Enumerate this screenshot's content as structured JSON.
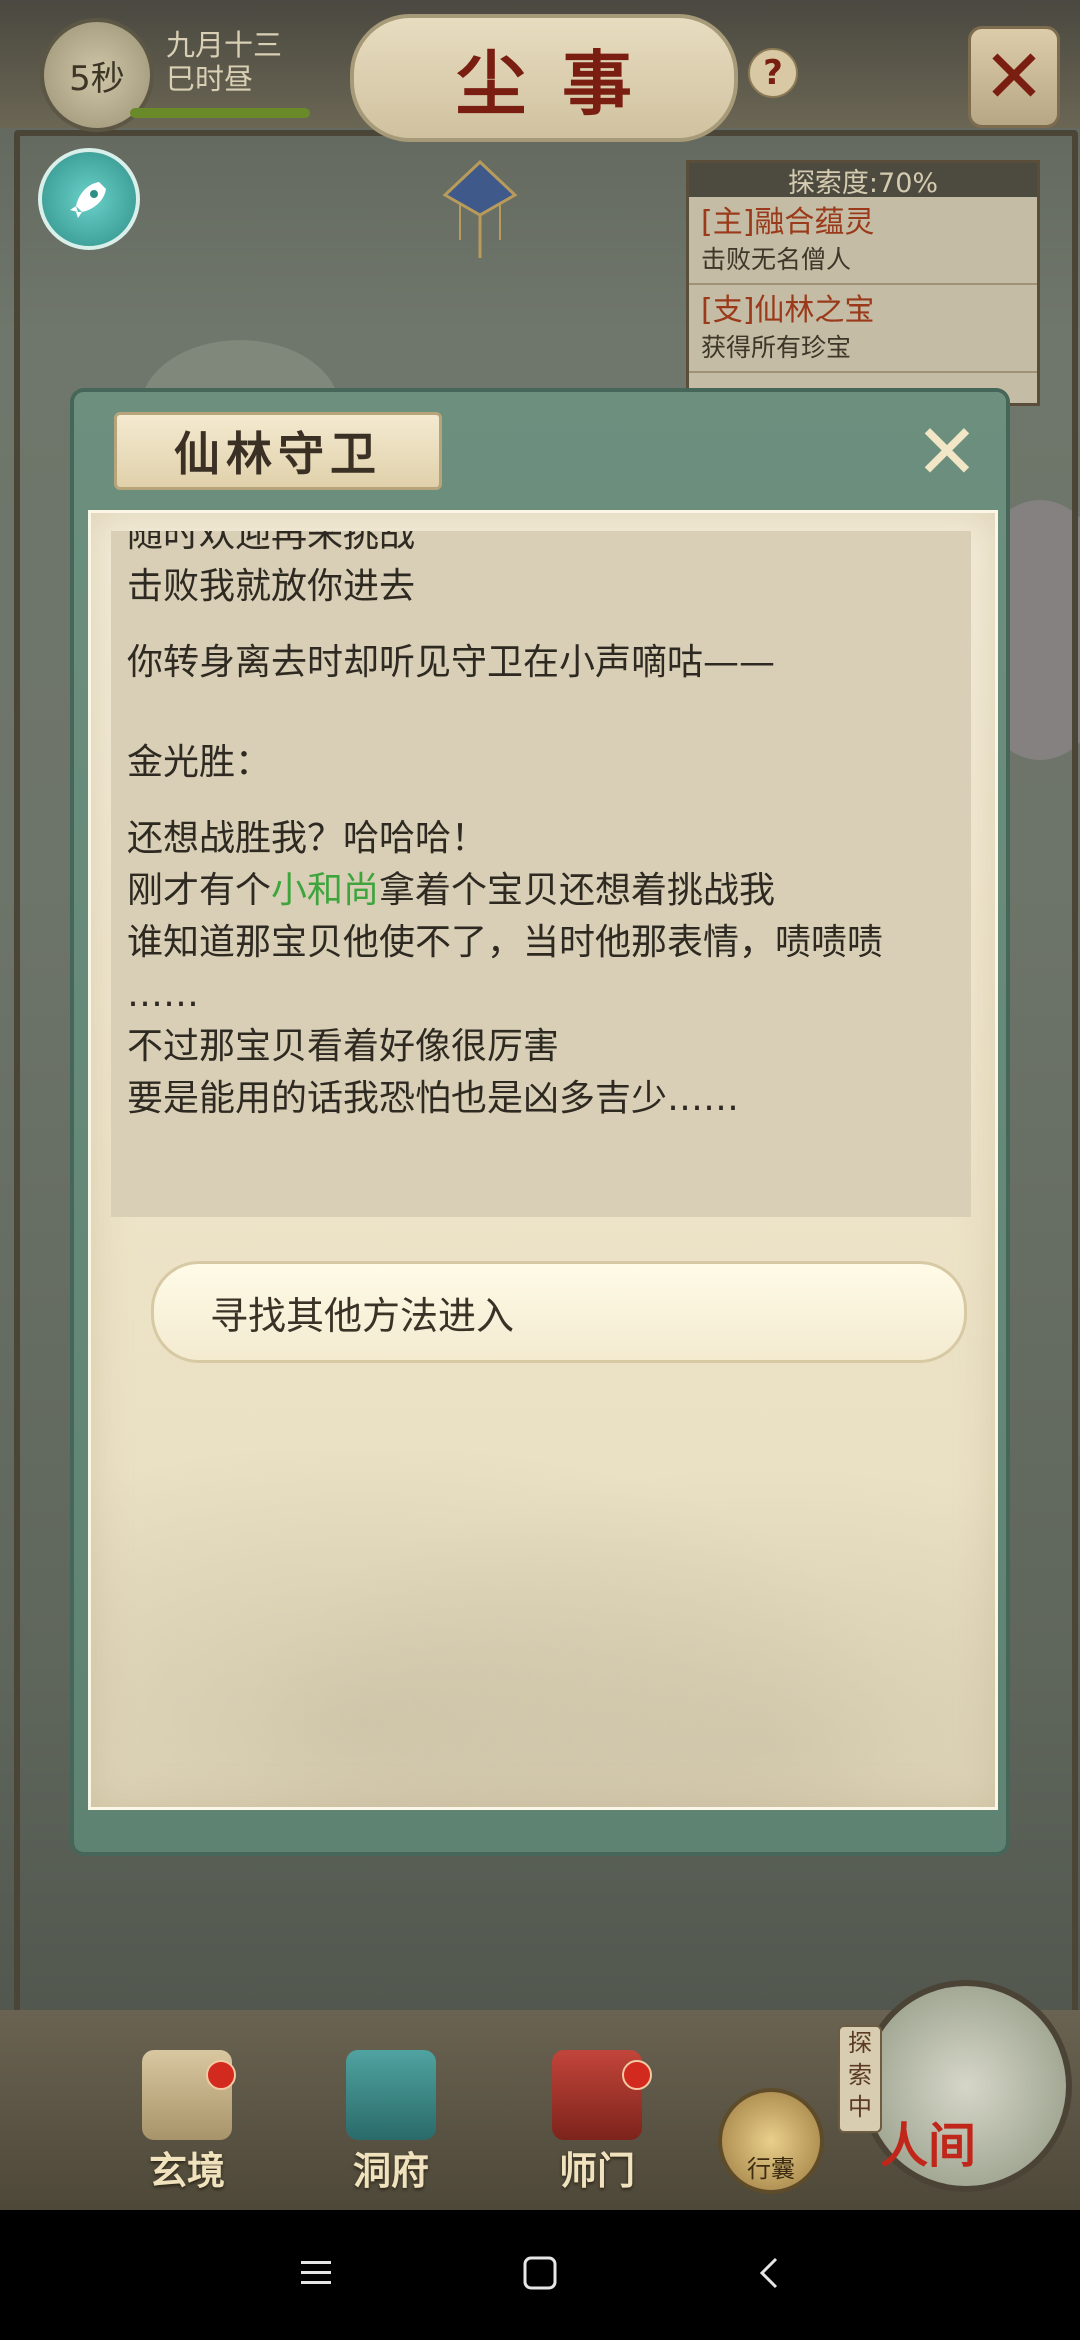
{
  "topbar": {
    "timer": "5秒",
    "date_line1": "九月十三",
    "date_line2": "巳时昼",
    "title": "尘事",
    "help_icon": "?",
    "close_icon": "✕"
  },
  "quest_panel": {
    "header": "探索度:70%",
    "items": [
      {
        "title": "[主]融合蕴灵",
        "desc": "击败无名僧人"
      },
      {
        "title": "[支]仙林之宝",
        "desc": "获得所有珍宝"
      }
    ]
  },
  "dialog": {
    "title": "仙林守卫",
    "lines": {
      "l1": "随时欢迎再来挑战",
      "l2": "击败我就放你进去",
      "l3": "你转身离去时却听见守卫在小声嘀咕——",
      "l4": "金光胜：",
      "l5": "还想战胜我？哈哈哈！",
      "l6a": "刚才有个",
      "l6b": "小和尚",
      "l6c": "拿着个宝贝还想着挑战我",
      "l7": "谁知道那宝贝他使不了，当时他那表情，啧啧啧",
      "l8": "……",
      "l9": "不过那宝贝看着好像很厉害",
      "l10": "要是能用的话我恐怕也是凶多吉少……"
    },
    "option": "寻找其他方法进入"
  },
  "bottom_nav": {
    "items": [
      {
        "label": "玄境"
      },
      {
        "label": "洞府"
      },
      {
        "label": "师门"
      }
    ],
    "bag_label": "行囊",
    "explore_tag": "探索中",
    "world_label": "人间"
  },
  "colors": {
    "title_red": "#7a1e12",
    "highlight_green": "#3ea53e",
    "quest_title": "#9a3a1a"
  }
}
